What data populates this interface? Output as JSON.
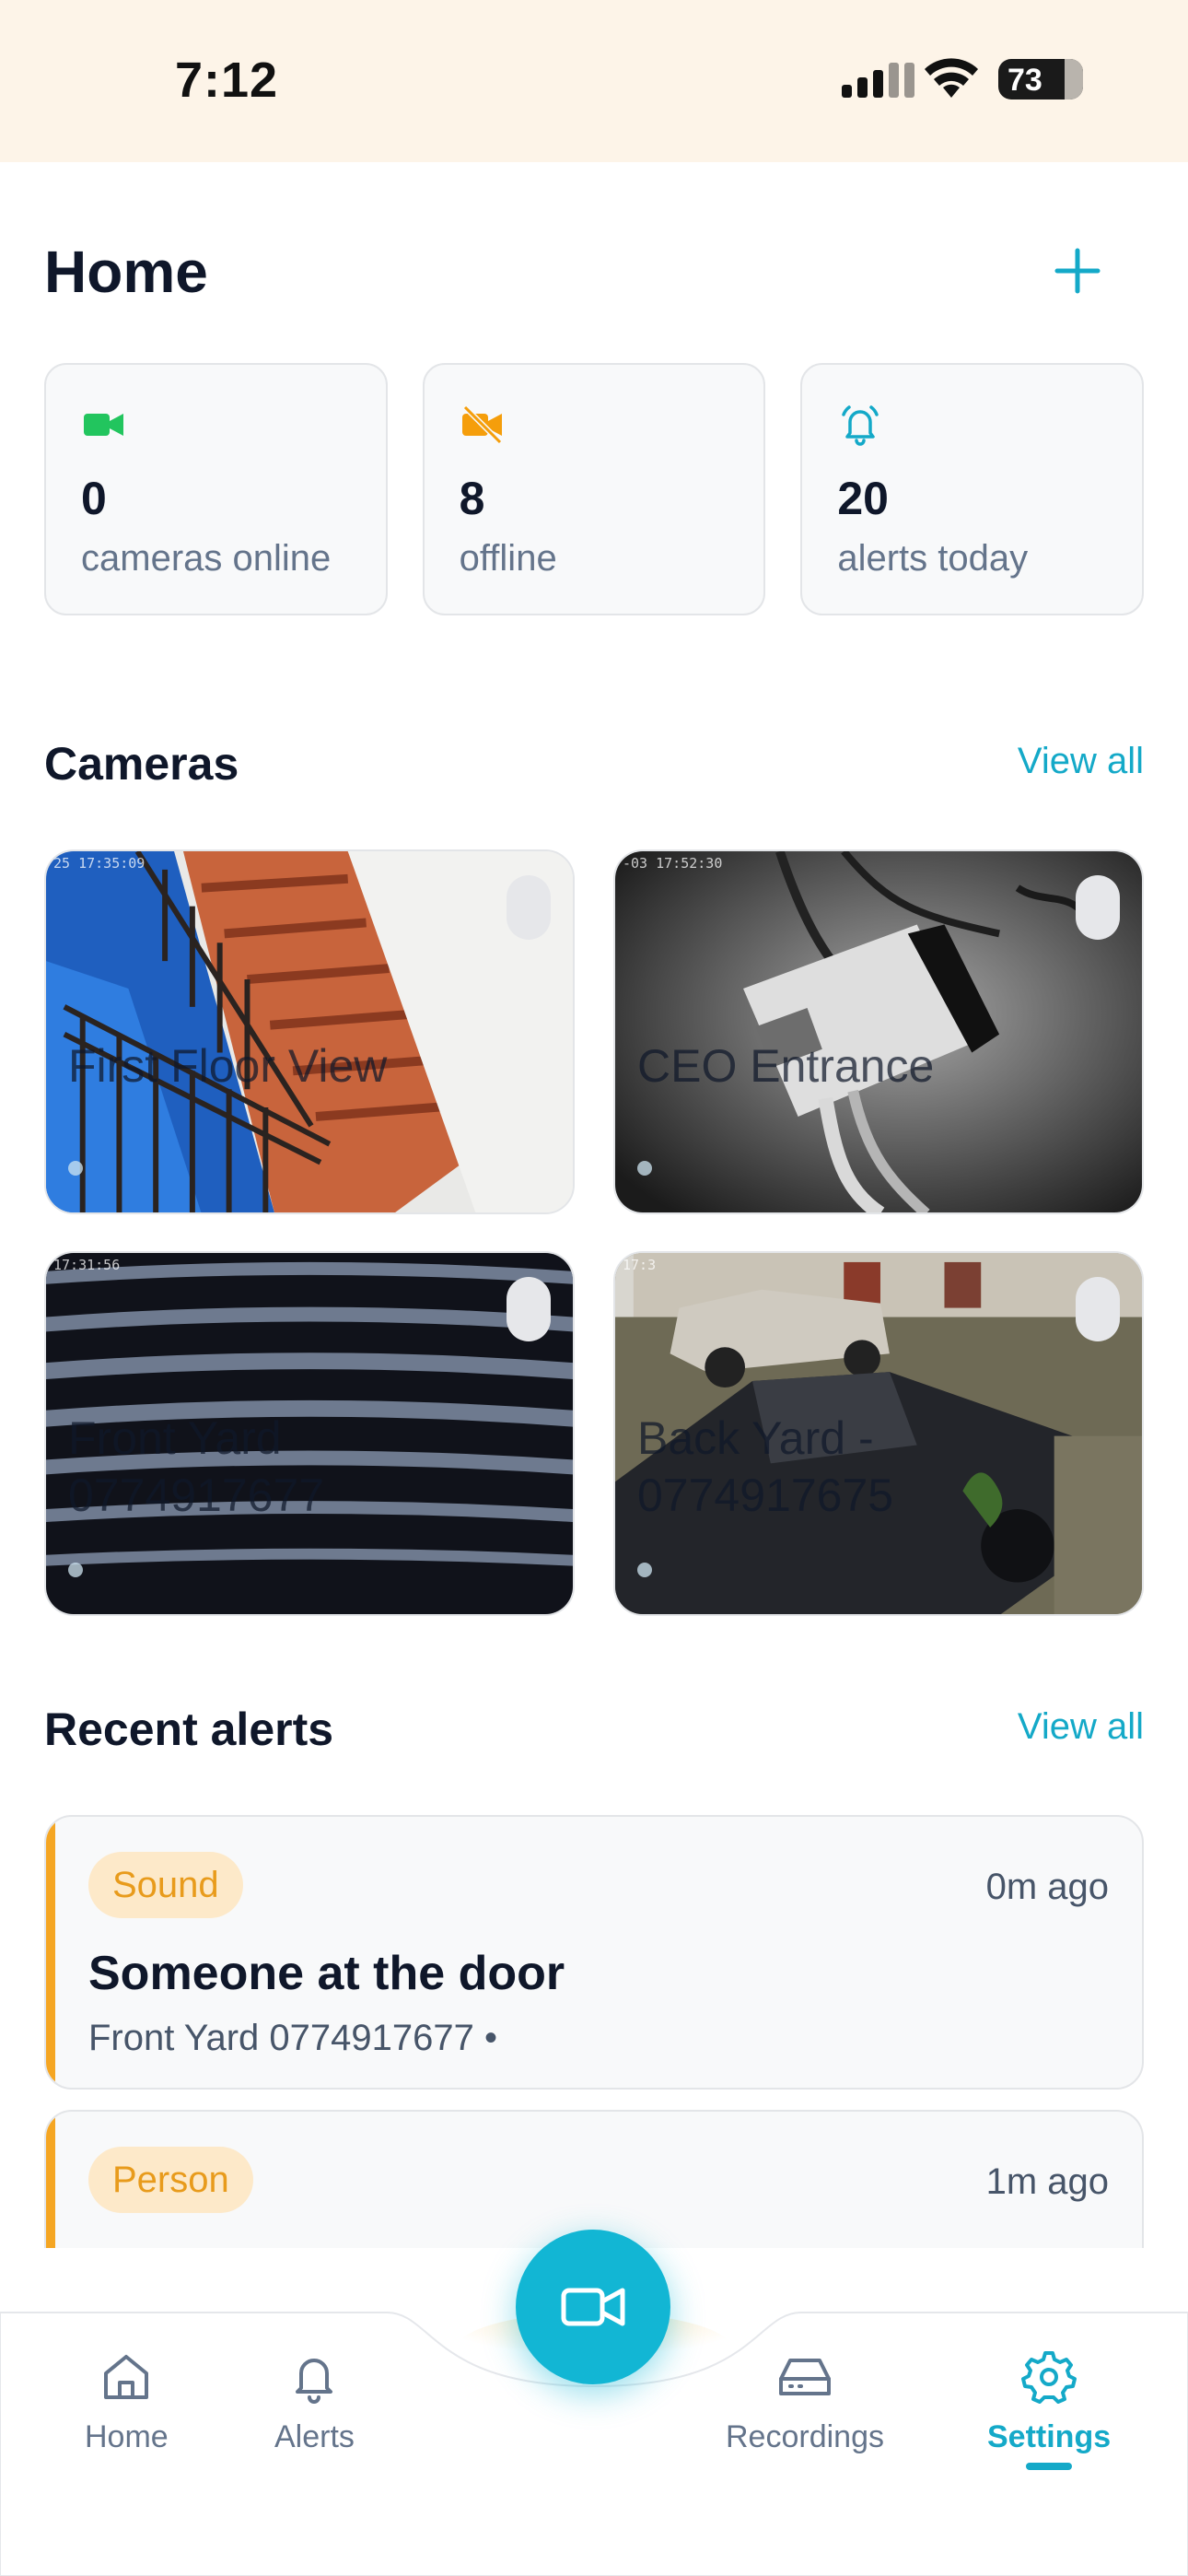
{
  "status_bar": {
    "time": "7:12",
    "battery": "73"
  },
  "header": {
    "title": "Home"
  },
  "stats": [
    {
      "value": "0",
      "label": "cameras online",
      "icon": "video-camera-icon",
      "color": "#22c55e"
    },
    {
      "value": "8",
      "label": "offline",
      "icon": "video-off-icon",
      "color": "#f59e0b"
    },
    {
      "value": "20",
      "label": "alerts today",
      "icon": "bell-ring-icon",
      "color": "#14a9c8"
    }
  ],
  "cameras_section": {
    "title": "Cameras",
    "view_all": "View all",
    "cameras": [
      {
        "name": "First Floor View",
        "timestamp": "25 17:35:09"
      },
      {
        "name": "CEO Entrance",
        "timestamp": "-03 17:52:30"
      },
      {
        "name": "Front Yard 0774917677",
        "timestamp": "17:31:56"
      },
      {
        "name": "Back Yard - 0774917675",
        "timestamp": "17:3"
      }
    ]
  },
  "alerts_section": {
    "title": "Recent alerts",
    "view_all": "View all",
    "alerts": [
      {
        "tag": "Sound",
        "time": "0m ago",
        "title": "Someone at the door",
        "subtitle": "Front Yard 0774917677 •"
      },
      {
        "tag": "Person",
        "time": "1m ago",
        "title": "",
        "subtitle": ""
      }
    ]
  },
  "nav": {
    "items": [
      {
        "label": "Home",
        "icon": "home-icon"
      },
      {
        "label": "Alerts",
        "icon": "bell-icon"
      },
      {
        "label": "Recordings",
        "icon": "hard-drive-icon"
      },
      {
        "label": "Settings",
        "icon": "gear-icon"
      }
    ],
    "active": "Settings",
    "accent": "#14a9c8"
  }
}
